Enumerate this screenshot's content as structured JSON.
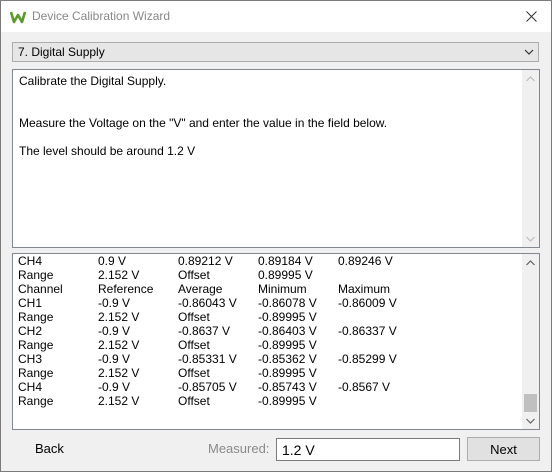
{
  "window": {
    "title": "Device Calibration Wizard"
  },
  "step_select": {
    "value": "7. Digital Supply"
  },
  "instructions": {
    "lines": [
      "Calibrate the Digital Supply.",
      "",
      "Measure the Voltage on the \"V\" and enter the value in the field below.",
      "",
      "The level should be around 1.2 V"
    ]
  },
  "log": {
    "rows": [
      [
        "CH4",
        "0.9 V",
        "0.89212 V",
        "0.89184 V",
        "0.89246 V"
      ],
      [
        "Range",
        "2.152 V",
        "Offset",
        "0.89995 V",
        ""
      ],
      [
        "Channel",
        "Reference",
        "Average",
        "Minimum",
        "Maximum"
      ],
      [
        "CH1",
        "-0.9 V",
        "-0.86043 V",
        "-0.86078 V",
        "-0.86009 V"
      ],
      [
        "Range",
        "2.152 V",
        "Offset",
        "-0.89995 V",
        ""
      ],
      [
        "CH2",
        "-0.9 V",
        "-0.8637 V",
        "-0.86403 V",
        "-0.86337 V"
      ],
      [
        "Range",
        "2.152 V",
        "Offset",
        "-0.89995 V",
        ""
      ],
      [
        "CH3",
        "-0.9 V",
        "-0.85331 V",
        "-0.85362 V",
        "-0.85299 V"
      ],
      [
        "Range",
        "2.152 V",
        "Offset",
        "-0.89995 V",
        ""
      ],
      [
        "CH4",
        "-0.9 V",
        "-0.85705 V",
        "-0.85743 V",
        "-0.8567 V"
      ],
      [
        "Range",
        "2.152 V",
        "Offset",
        "-0.89995 V",
        ""
      ]
    ]
  },
  "footer": {
    "back_label": "Back",
    "measured_label": "Measured:",
    "measured_value": "1.2 V",
    "next_label": "Next"
  },
  "icons": {
    "app": "w-logo-icon",
    "close": "close-icon",
    "dropdown": "chevron-down-icon"
  },
  "colors": {
    "app_icon": "#5a9a2a"
  }
}
